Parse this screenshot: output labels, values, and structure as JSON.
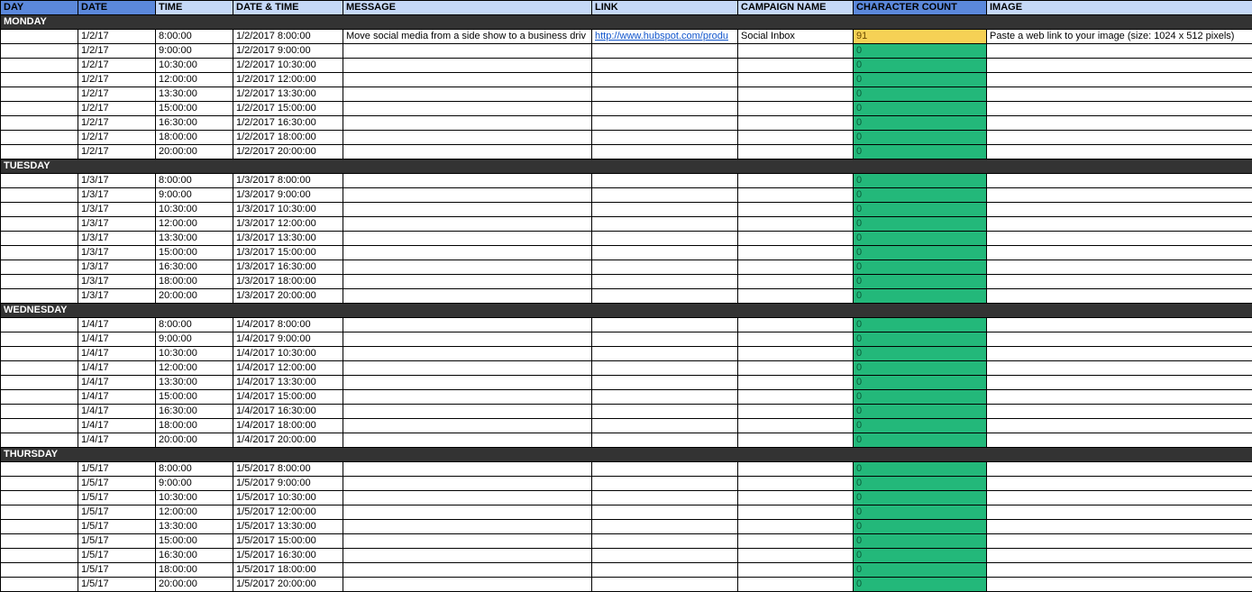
{
  "headers": {
    "day": {
      "label": "DAY",
      "shade": "dark"
    },
    "date": {
      "label": "DATE",
      "shade": "dark"
    },
    "time": {
      "label": "TIME",
      "shade": "light"
    },
    "datetime": {
      "label": "DATE & TIME",
      "shade": "light"
    },
    "message": {
      "label": "MESSAGE",
      "shade": "light"
    },
    "link": {
      "label": "LINK",
      "shade": "light"
    },
    "campaign": {
      "label": "CAMPAIGN NAME",
      "shade": "light"
    },
    "charcount": {
      "label": "CHARACTER COUNT",
      "shade": "dark"
    },
    "image": {
      "label": "IMAGE",
      "shade": "light"
    }
  },
  "days": [
    {
      "label": "MONDAY",
      "rows": [
        {
          "date": "1/2/17",
          "time": "8:00:00",
          "datetime": "1/2/2017 8:00:00",
          "message": "Move social media from a side show to a business driv",
          "link": "http://www.hubspot.com/produ",
          "campaign": "Social Inbox",
          "charcount": "91",
          "cc_style": "yellow",
          "image": "Paste a web link to your image (size: 1024 x 512 pixels)"
        },
        {
          "date": "1/2/17",
          "time": "9:00:00",
          "datetime": "1/2/2017 9:00:00",
          "message": "",
          "link": "",
          "campaign": "",
          "charcount": "0",
          "cc_style": "green",
          "image": ""
        },
        {
          "date": "1/2/17",
          "time": "10:30:00",
          "datetime": "1/2/2017 10:30:00",
          "message": "",
          "link": "",
          "campaign": "",
          "charcount": "0",
          "cc_style": "green",
          "image": ""
        },
        {
          "date": "1/2/17",
          "time": "12:00:00",
          "datetime": "1/2/2017 12:00:00",
          "message": "",
          "link": "",
          "campaign": "",
          "charcount": "0",
          "cc_style": "green",
          "image": ""
        },
        {
          "date": "1/2/17",
          "time": "13:30:00",
          "datetime": "1/2/2017 13:30:00",
          "message": "",
          "link": "",
          "campaign": "",
          "charcount": "0",
          "cc_style": "green",
          "image": ""
        },
        {
          "date": "1/2/17",
          "time": "15:00:00",
          "datetime": "1/2/2017 15:00:00",
          "message": "",
          "link": "",
          "campaign": "",
          "charcount": "0",
          "cc_style": "green",
          "image": ""
        },
        {
          "date": "1/2/17",
          "time": "16:30:00",
          "datetime": "1/2/2017 16:30:00",
          "message": "",
          "link": "",
          "campaign": "",
          "charcount": "0",
          "cc_style": "green",
          "image": ""
        },
        {
          "date": "1/2/17",
          "time": "18:00:00",
          "datetime": "1/2/2017 18:00:00",
          "message": "",
          "link": "",
          "campaign": "",
          "charcount": "0",
          "cc_style": "green",
          "image": ""
        },
        {
          "date": "1/2/17",
          "time": "20:00:00",
          "datetime": "1/2/2017 20:00:00",
          "message": "",
          "link": "",
          "campaign": "",
          "charcount": "0",
          "cc_style": "green",
          "image": ""
        }
      ]
    },
    {
      "label": "TUESDAY",
      "rows": [
        {
          "date": "1/3/17",
          "time": "8:00:00",
          "datetime": "1/3/2017 8:00:00",
          "message": "",
          "link": "",
          "campaign": "",
          "charcount": "0",
          "cc_style": "green",
          "image": ""
        },
        {
          "date": "1/3/17",
          "time": "9:00:00",
          "datetime": "1/3/2017 9:00:00",
          "message": "",
          "link": "",
          "campaign": "",
          "charcount": "0",
          "cc_style": "green",
          "image": ""
        },
        {
          "date": "1/3/17",
          "time": "10:30:00",
          "datetime": "1/3/2017 10:30:00",
          "message": "",
          "link": "",
          "campaign": "",
          "charcount": "0",
          "cc_style": "green",
          "image": ""
        },
        {
          "date": "1/3/17",
          "time": "12:00:00",
          "datetime": "1/3/2017 12:00:00",
          "message": "",
          "link": "",
          "campaign": "",
          "charcount": "0",
          "cc_style": "green",
          "image": ""
        },
        {
          "date": "1/3/17",
          "time": "13:30:00",
          "datetime": "1/3/2017 13:30:00",
          "message": "",
          "link": "",
          "campaign": "",
          "charcount": "0",
          "cc_style": "green",
          "image": ""
        },
        {
          "date": "1/3/17",
          "time": "15:00:00",
          "datetime": "1/3/2017 15:00:00",
          "message": "",
          "link": "",
          "campaign": "",
          "charcount": "0",
          "cc_style": "green",
          "image": ""
        },
        {
          "date": "1/3/17",
          "time": "16:30:00",
          "datetime": "1/3/2017 16:30:00",
          "message": "",
          "link": "",
          "campaign": "",
          "charcount": "0",
          "cc_style": "green",
          "image": ""
        },
        {
          "date": "1/3/17",
          "time": "18:00:00",
          "datetime": "1/3/2017 18:00:00",
          "message": "",
          "link": "",
          "campaign": "",
          "charcount": "0",
          "cc_style": "green",
          "image": ""
        },
        {
          "date": "1/3/17",
          "time": "20:00:00",
          "datetime": "1/3/2017 20:00:00",
          "message": "",
          "link": "",
          "campaign": "",
          "charcount": "0",
          "cc_style": "green",
          "image": ""
        }
      ]
    },
    {
      "label": "WEDNESDAY",
      "rows": [
        {
          "date": "1/4/17",
          "time": "8:00:00",
          "datetime": "1/4/2017 8:00:00",
          "message": "",
          "link": "",
          "campaign": "",
          "charcount": "0",
          "cc_style": "green",
          "image": ""
        },
        {
          "date": "1/4/17",
          "time": "9:00:00",
          "datetime": "1/4/2017 9:00:00",
          "message": "",
          "link": "",
          "campaign": "",
          "charcount": "0",
          "cc_style": "green",
          "image": ""
        },
        {
          "date": "1/4/17",
          "time": "10:30:00",
          "datetime": "1/4/2017 10:30:00",
          "message": "",
          "link": "",
          "campaign": "",
          "charcount": "0",
          "cc_style": "green",
          "image": ""
        },
        {
          "date": "1/4/17",
          "time": "12:00:00",
          "datetime": "1/4/2017 12:00:00",
          "message": "",
          "link": "",
          "campaign": "",
          "charcount": "0",
          "cc_style": "green",
          "image": ""
        },
        {
          "date": "1/4/17",
          "time": "13:30:00",
          "datetime": "1/4/2017 13:30:00",
          "message": "",
          "link": "",
          "campaign": "",
          "charcount": "0",
          "cc_style": "green",
          "image": ""
        },
        {
          "date": "1/4/17",
          "time": "15:00:00",
          "datetime": "1/4/2017 15:00:00",
          "message": "",
          "link": "",
          "campaign": "",
          "charcount": "0",
          "cc_style": "green",
          "image": ""
        },
        {
          "date": "1/4/17",
          "time": "16:30:00",
          "datetime": "1/4/2017 16:30:00",
          "message": "",
          "link": "",
          "campaign": "",
          "charcount": "0",
          "cc_style": "green",
          "image": ""
        },
        {
          "date": "1/4/17",
          "time": "18:00:00",
          "datetime": "1/4/2017 18:00:00",
          "message": "",
          "link": "",
          "campaign": "",
          "charcount": "0",
          "cc_style": "green",
          "image": ""
        },
        {
          "date": "1/4/17",
          "time": "20:00:00",
          "datetime": "1/4/2017 20:00:00",
          "message": "",
          "link": "",
          "campaign": "",
          "charcount": "0",
          "cc_style": "green",
          "image": ""
        }
      ]
    },
    {
      "label": "THURSDAY",
      "rows": [
        {
          "date": "1/5/17",
          "time": "8:00:00",
          "datetime": "1/5/2017 8:00:00",
          "message": "",
          "link": "",
          "campaign": "",
          "charcount": "0",
          "cc_style": "green",
          "image": ""
        },
        {
          "date": "1/5/17",
          "time": "9:00:00",
          "datetime": "1/5/2017 9:00:00",
          "message": "",
          "link": "",
          "campaign": "",
          "charcount": "0",
          "cc_style": "green",
          "image": ""
        },
        {
          "date": "1/5/17",
          "time": "10:30:00",
          "datetime": "1/5/2017 10:30:00",
          "message": "",
          "link": "",
          "campaign": "",
          "charcount": "0",
          "cc_style": "green",
          "image": ""
        },
        {
          "date": "1/5/17",
          "time": "12:00:00",
          "datetime": "1/5/2017 12:00:00",
          "message": "",
          "link": "",
          "campaign": "",
          "charcount": "0",
          "cc_style": "green",
          "image": ""
        },
        {
          "date": "1/5/17",
          "time": "13:30:00",
          "datetime": "1/5/2017 13:30:00",
          "message": "",
          "link": "",
          "campaign": "",
          "charcount": "0",
          "cc_style": "green",
          "image": ""
        },
        {
          "date": "1/5/17",
          "time": "15:00:00",
          "datetime": "1/5/2017 15:00:00",
          "message": "",
          "link": "",
          "campaign": "",
          "charcount": "0",
          "cc_style": "green",
          "image": ""
        },
        {
          "date": "1/5/17",
          "time": "16:30:00",
          "datetime": "1/5/2017 16:30:00",
          "message": "",
          "link": "",
          "campaign": "",
          "charcount": "0",
          "cc_style": "green",
          "image": ""
        },
        {
          "date": "1/5/17",
          "time": "18:00:00",
          "datetime": "1/5/2017 18:00:00",
          "message": "",
          "link": "",
          "campaign": "",
          "charcount": "0",
          "cc_style": "green",
          "image": ""
        },
        {
          "date": "1/5/17",
          "time": "20:00:00",
          "datetime": "1/5/2017 20:00:00",
          "message": "",
          "link": "",
          "campaign": "",
          "charcount": "0",
          "cc_style": "green",
          "image": ""
        }
      ]
    }
  ]
}
